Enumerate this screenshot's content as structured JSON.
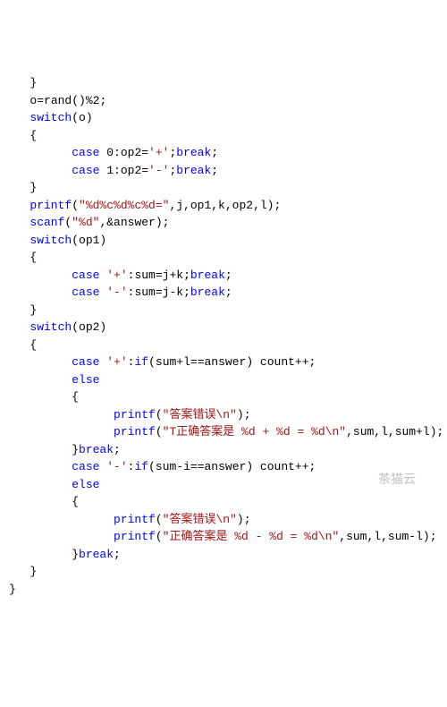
{
  "watermark": "茶猫云",
  "lines": [
    {
      "indent": 1,
      "tokens": [
        {
          "t": "br",
          "v": "}"
        }
      ]
    },
    {
      "indent": 1,
      "tokens": [
        {
          "t": "pl",
          "v": "o="
        },
        {
          "t": "fn",
          "v": "rand"
        },
        {
          "t": "br",
          "v": "()"
        },
        {
          "t": "pl",
          "v": "%2;"
        }
      ]
    },
    {
      "indent": 1,
      "tokens": [
        {
          "t": "kw",
          "v": "switch"
        },
        {
          "t": "br",
          "v": "(o)"
        }
      ]
    },
    {
      "indent": 1,
      "tokens": [
        {
          "t": "br",
          "v": "{"
        }
      ]
    },
    {
      "indent": 3,
      "tokens": [
        {
          "t": "kw",
          "v": "case"
        },
        {
          "t": "pl",
          "v": " 0:op2="
        },
        {
          "t": "str",
          "v": "'+'"
        },
        {
          "t": "pl",
          "v": ";"
        },
        {
          "t": "kw",
          "v": "break"
        },
        {
          "t": "pl",
          "v": ";"
        }
      ]
    },
    {
      "indent": 3,
      "tokens": [
        {
          "t": "kw",
          "v": "case"
        },
        {
          "t": "pl",
          "v": " 1:op2="
        },
        {
          "t": "str",
          "v": "'-'"
        },
        {
          "t": "pl",
          "v": ";"
        },
        {
          "t": "kw",
          "v": "break"
        },
        {
          "t": "pl",
          "v": ";"
        }
      ]
    },
    {
      "indent": 1,
      "tokens": [
        {
          "t": "br",
          "v": "}"
        }
      ]
    },
    {
      "indent": 1,
      "tokens": [
        {
          "t": "bluefn",
          "v": "printf"
        },
        {
          "t": "br",
          "v": "("
        },
        {
          "t": "str",
          "v": "\"%d%c%d%c%d=\""
        },
        {
          "t": "pl",
          "v": ",j,op1,k,op2,l);"
        }
      ]
    },
    {
      "indent": 1,
      "tokens": [
        {
          "t": "bluefn",
          "v": "scanf"
        },
        {
          "t": "br",
          "v": "("
        },
        {
          "t": "str",
          "v": "\"%d\""
        },
        {
          "t": "pl",
          "v": ",&answer);"
        }
      ]
    },
    {
      "indent": 1,
      "tokens": [
        {
          "t": "kw",
          "v": "switch"
        },
        {
          "t": "br",
          "v": "(op1)"
        }
      ]
    },
    {
      "indent": 1,
      "tokens": [
        {
          "t": "br",
          "v": "{"
        }
      ]
    },
    {
      "indent": 0,
      "tokens": [
        {
          "t": "pl",
          "v": ""
        }
      ]
    },
    {
      "indent": 3,
      "tokens": [
        {
          "t": "kw",
          "v": "case"
        },
        {
          "t": "pl",
          "v": " "
        },
        {
          "t": "str",
          "v": "'+'"
        },
        {
          "t": "pl",
          "v": ":sum=j+k;"
        },
        {
          "t": "kw",
          "v": "break"
        },
        {
          "t": "pl",
          "v": ";"
        }
      ]
    },
    {
      "indent": 3,
      "tokens": [
        {
          "t": "kw",
          "v": "case"
        },
        {
          "t": "pl",
          "v": " "
        },
        {
          "t": "str",
          "v": "'-'"
        },
        {
          "t": "pl",
          "v": ":sum=j-k;"
        },
        {
          "t": "kw",
          "v": "break"
        },
        {
          "t": "pl",
          "v": ";"
        }
      ]
    },
    {
      "indent": 1,
      "tokens": [
        {
          "t": "br",
          "v": "}"
        }
      ]
    },
    {
      "indent": 1,
      "tokens": [
        {
          "t": "kw",
          "v": "switch"
        },
        {
          "t": "br",
          "v": "(op2)"
        }
      ]
    },
    {
      "indent": 1,
      "tokens": [
        {
          "t": "br",
          "v": "{"
        }
      ]
    },
    {
      "indent": 3,
      "tokens": [
        {
          "t": "kw",
          "v": "case"
        },
        {
          "t": "pl",
          "v": " "
        },
        {
          "t": "str",
          "v": "'+'"
        },
        {
          "t": "pl",
          "v": ":"
        },
        {
          "t": "kw",
          "v": "if"
        },
        {
          "t": "br",
          "v": "("
        },
        {
          "t": "pl",
          "v": "sum+l==answer"
        },
        {
          "t": "br",
          "v": ")"
        },
        {
          "t": "pl",
          "v": " count++;"
        }
      ]
    },
    {
      "indent": 3,
      "tokens": [
        {
          "t": "kw",
          "v": "else"
        }
      ]
    },
    {
      "indent": 3,
      "tokens": [
        {
          "t": "br",
          "v": "{"
        }
      ]
    },
    {
      "indent": 5,
      "tokens": [
        {
          "t": "bluefn",
          "v": "printf"
        },
        {
          "t": "br",
          "v": "("
        },
        {
          "t": "str",
          "v": "\"答案错误\\n\""
        },
        {
          "t": "br",
          "v": ")"
        },
        {
          "t": "pl",
          "v": ";"
        }
      ]
    },
    {
      "indent": 5,
      "tokens": [
        {
          "t": "bluefn",
          "v": "printf"
        },
        {
          "t": "br",
          "v": "("
        },
        {
          "t": "str",
          "v": "\"T正确答案是 %d + %d = %d\\n\""
        },
        {
          "t": "pl",
          "v": ",sum,l,sum+l);"
        }
      ]
    },
    {
      "indent": 3,
      "tokens": [
        {
          "t": "br",
          "v": "}"
        },
        {
          "t": "kw",
          "v": "break"
        },
        {
          "t": "pl",
          "v": ";"
        }
      ]
    },
    {
      "indent": 3,
      "tokens": [
        {
          "t": "kw",
          "v": "case"
        },
        {
          "t": "pl",
          "v": " "
        },
        {
          "t": "str",
          "v": "'-'"
        },
        {
          "t": "pl",
          "v": ":"
        },
        {
          "t": "kw",
          "v": "if"
        },
        {
          "t": "br",
          "v": "("
        },
        {
          "t": "pl",
          "v": "sum-i==answer"
        },
        {
          "t": "br",
          "v": ")"
        },
        {
          "t": "pl",
          "v": " count++;"
        }
      ]
    },
    {
      "indent": 3,
      "tokens": [
        {
          "t": "kw",
          "v": "else"
        }
      ]
    },
    {
      "indent": 3,
      "tokens": [
        {
          "t": "br",
          "v": "{"
        }
      ]
    },
    {
      "indent": 5,
      "tokens": [
        {
          "t": "bluefn",
          "v": "printf"
        },
        {
          "t": "br",
          "v": "("
        },
        {
          "t": "str",
          "v": "\"答案错误\\n\""
        },
        {
          "t": "br",
          "v": ")"
        },
        {
          "t": "pl",
          "v": ";"
        }
      ]
    },
    {
      "indent": 5,
      "tokens": [
        {
          "t": "bluefn",
          "v": "printf"
        },
        {
          "t": "br",
          "v": "("
        },
        {
          "t": "str",
          "v": "\"正确答案是 %d - %d = %d\\n\""
        },
        {
          "t": "pl",
          "v": ",sum,l,sum-l);"
        }
      ]
    },
    {
      "indent": 3,
      "tokens": [
        {
          "t": "br",
          "v": "}"
        },
        {
          "t": "kw",
          "v": "break"
        },
        {
          "t": "pl",
          "v": ";"
        }
      ]
    },
    {
      "indent": 1,
      "tokens": [
        {
          "t": "br",
          "v": "}"
        }
      ]
    },
    {
      "indent": 0,
      "tokens": [
        {
          "t": "br",
          "v": "}"
        }
      ]
    }
  ]
}
